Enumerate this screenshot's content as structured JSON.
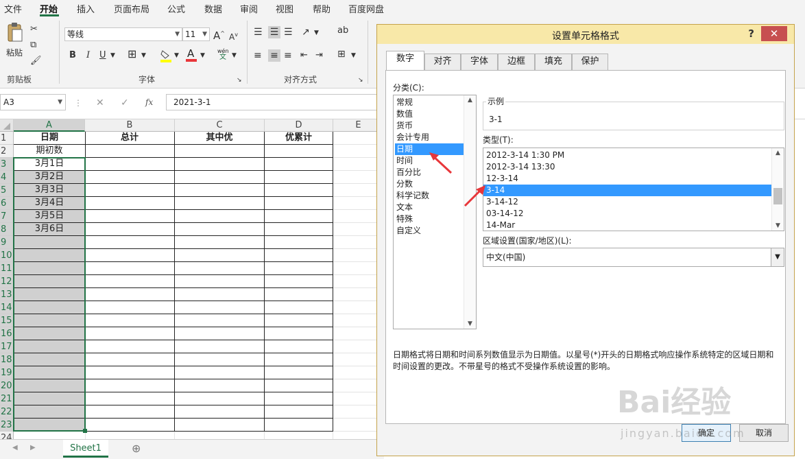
{
  "menu": {
    "items": [
      "文件",
      "开始",
      "插入",
      "页面布局",
      "公式",
      "数据",
      "审阅",
      "视图",
      "帮助",
      "百度网盘"
    ]
  },
  "ribbon": {
    "clipboard": {
      "paste_label": "粘贴",
      "group_label": "剪贴板"
    },
    "font": {
      "font_name": "等线",
      "font_size": "11",
      "group_label": "字体",
      "bold": "B",
      "italic": "I",
      "underline": "U",
      "grow": "A",
      "shrink": "A",
      "wen": "wén",
      "wen2": "文"
    },
    "alignment": {
      "group_label": "对齐方式",
      "wrap_icon": "ab"
    }
  },
  "formula_bar": {
    "name_box": "A3",
    "cancel": "✕",
    "enter": "✓",
    "fx": "fx",
    "formula": "2021-3-1"
  },
  "sheet": {
    "columns": [
      "A",
      "B",
      "C",
      "D",
      "E"
    ],
    "rows": [
      "1",
      "2",
      "3",
      "4",
      "5",
      "6",
      "7",
      "8",
      "9",
      "10",
      "11",
      "12",
      "13",
      "14",
      "15",
      "16",
      "17",
      "18",
      "19",
      "20",
      "21",
      "22",
      "23",
      "24"
    ],
    "headers": [
      "日期",
      "总计",
      "其中优",
      "优累计"
    ],
    "col_a": [
      "期初数",
      "3月1日",
      "3月2日",
      "3月3日",
      "3月4日",
      "3月5日",
      "3月6日"
    ],
    "tab": "Sheet1"
  },
  "dialog": {
    "title": "设置单元格格式",
    "help": "?",
    "close": "✕",
    "tabs": [
      "数字",
      "对齐",
      "字体",
      "边框",
      "填充",
      "保护"
    ],
    "category_label": "分类(C):",
    "categories": [
      "常规",
      "数值",
      "货币",
      "会计专用",
      "日期",
      "时间",
      "百分比",
      "分数",
      "科学记数",
      "文本",
      "特殊",
      "自定义"
    ],
    "selected_category": "日期",
    "sample_label": "示例",
    "sample_value": "3-1",
    "type_label": "类型(T):",
    "types": [
      "2012-3-14 1:30 PM",
      "2012-3-14 13:30",
      "12-3-14",
      "3-14",
      "3-14-12",
      "03-14-12",
      "14-Mar"
    ],
    "selected_type": "3-14",
    "locale_label": "区域设置(国家/地区)(L):",
    "locale_value": "中文(中国)",
    "description": "日期格式将日期和时间系列数值显示为日期值。以星号(*)开头的日期格式响应操作系统特定的区域日期和时间设置的更改。不带星号的格式不受操作系统设置的影响。",
    "ok": "确定",
    "cancel": "取消"
  },
  "colors": {
    "excel_green": "#217346",
    "selection_blue": "#3399ff",
    "annotation_red": "#e8363a",
    "dialog_title": "#f8e8a8"
  },
  "watermark": {
    "brand": "Bai经验",
    "url": "jingyan.baidu.com"
  }
}
